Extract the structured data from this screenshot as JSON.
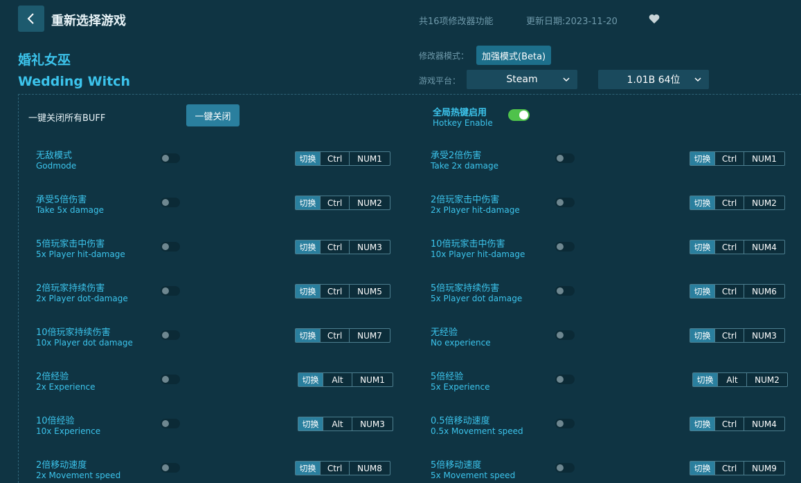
{
  "header": {
    "title": "重新选择游戏",
    "feature_count": "共16项修改器功能",
    "update_date": "更新日期:2023-11-20"
  },
  "game": {
    "name_cn": "婚礼女巫",
    "name_en": "Wedding Witch"
  },
  "settings": {
    "mode_label": "修改器模式：",
    "mode_value": "加强模式(Beta)",
    "platform_label": "游戏平台：",
    "platform_value": "Steam",
    "version_value": "1.01B 64位"
  },
  "controls": {
    "buff_label": "一键关闭所有BUFF",
    "buff_button": "一键关闭",
    "hotkey_cn": "全局热键启用",
    "hotkey_en": "Hotkey Enable",
    "hotkey_enabled": true
  },
  "switch_label": "切换",
  "features": [
    {
      "cn": "无敌模式",
      "en": "Godmode",
      "mod": "Ctrl",
      "key": "NUM1",
      "on": false
    },
    {
      "cn": "承受2倍伤害",
      "en": "Take 2x damage",
      "mod": "Ctrl",
      "key": "NUM1",
      "on": false
    },
    {
      "cn": "承受5倍伤害",
      "en": "Take 5x damage",
      "mod": "Ctrl",
      "key": "NUM2",
      "on": false
    },
    {
      "cn": "2倍玩家击中伤害",
      "en": "2x Player hit-damage",
      "mod": "Ctrl",
      "key": "NUM2",
      "on": false
    },
    {
      "cn": "5倍玩家击中伤害",
      "en": "5x Player hit-damage",
      "mod": "Ctrl",
      "key": "NUM3",
      "on": false
    },
    {
      "cn": "10倍玩家击中伤害",
      "en": "10x Player hit-damage",
      "mod": "Ctrl",
      "key": "NUM4",
      "on": false
    },
    {
      "cn": "2倍玩家持续伤害",
      "en": "2x Player dot-damage",
      "mod": "Ctrl",
      "key": "NUM5",
      "on": false
    },
    {
      "cn": "5倍玩家持续伤害",
      "en": "5x Player dot damage",
      "mod": "Ctrl",
      "key": "NUM6",
      "on": false
    },
    {
      "cn": "10倍玩家持续伤害",
      "en": "10x Player dot damage",
      "mod": "Ctrl",
      "key": "NUM7",
      "on": false
    },
    {
      "cn": "无经验",
      "en": "No experience",
      "mod": "Ctrl",
      "key": "NUM3",
      "on": false
    },
    {
      "cn": "2倍经验",
      "en": "2x Experience",
      "mod": "Alt",
      "key": "NUM1",
      "on": false
    },
    {
      "cn": "5倍经验",
      "en": "5x Experience",
      "mod": "Alt",
      "key": "NUM2",
      "on": false
    },
    {
      "cn": "10倍经验",
      "en": "10x Experience",
      "mod": "Alt",
      "key": "NUM3",
      "on": false
    },
    {
      "cn": "0.5倍移动速度",
      "en": "0.5x Movement speed",
      "mod": "Ctrl",
      "key": "NUM4",
      "on": false
    },
    {
      "cn": "2倍移动速度",
      "en": "2x Movement speed",
      "mod": "Ctrl",
      "key": "NUM8",
      "on": false
    },
    {
      "cn": "5倍移动速度",
      "en": "5x Movement speed",
      "mod": "Ctrl",
      "key": "NUM9",
      "on": false
    }
  ],
  "colors": {
    "background": "#0f3443",
    "accent": "#3cc4ec",
    "button": "#2a7f9e",
    "toggle_on": "#4fc24b"
  }
}
